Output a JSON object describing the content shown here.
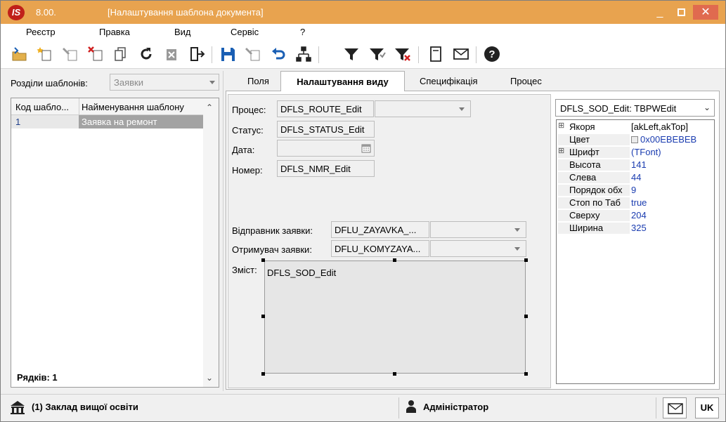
{
  "window": {
    "logo_text": "IS",
    "version": "8.00.",
    "title": "[Налаштування шаблона документа]",
    "buttons": {
      "minimize": "_",
      "close": "✕"
    }
  },
  "menu": [
    "Реєстр",
    "Правка",
    "Вид",
    "Сервіс",
    "?"
  ],
  "toolbar_icons": [
    "open-folder-icon",
    "new-item-icon",
    "edit-item-icon",
    "delete-item-icon",
    "copy-icon",
    "refresh-icon",
    "clear-icon",
    "exit-icon",
    "save-icon",
    "edit-icon",
    "undo-icon",
    "tree-icon",
    "filter-icon",
    "filter-set-icon",
    "filter-clear-icon",
    "document-icon",
    "mail-icon",
    "help-icon"
  ],
  "left_panel": {
    "sections_label": "Розділи шаблонів:",
    "sections_value": "Заявки",
    "columns": [
      "Код шабло...",
      "Найменування шаблону"
    ],
    "rows": [
      {
        "code": "1",
        "name": "Заявка на ремонт"
      }
    ],
    "rows_count": "Рядків: 1"
  },
  "tabs": [
    "Поля",
    "Налаштування виду",
    "Специфікація",
    "Процес"
  ],
  "active_tab": "Налаштування виду",
  "form": {
    "process_label": "Процес:",
    "process_value": "DFLS_ROUTE_Edit",
    "status_label": "Статус:",
    "status_value": "DFLS_STATUS_Edit",
    "date_label": "Дата:",
    "number_label": "Номер:",
    "number_value": "DFLS_NMR_Edit",
    "sender_label": "Відправник заявки:",
    "sender_value": "DFLU_ZAYAVKA_...",
    "receiver_label": "Отримувач заявки:",
    "receiver_value": "DFLU_KOMYZAYA...",
    "content_label": "Зміст:",
    "content_value": "DFLS_SOD_Edit"
  },
  "inspector": {
    "component": "DFLS_SOD_Edit: TBPWEdit",
    "properties": [
      {
        "name": "Якоря",
        "value": "[akLeft,akTop]",
        "expandable": true
      },
      {
        "name": "Цвет",
        "value": "0x00EBEBEB",
        "swatch": "#EBEBEB"
      },
      {
        "name": "Шрифт",
        "value": "(TFont)",
        "expandable": true
      },
      {
        "name": "Высота",
        "value": "141"
      },
      {
        "name": "Слева",
        "value": "44"
      },
      {
        "name": "Порядок обх",
        "value": "9"
      },
      {
        "name": "Стоп по Таб",
        "value": "true"
      },
      {
        "name": "Сверху",
        "value": "204"
      },
      {
        "name": "Ширина",
        "value": "325"
      }
    ]
  },
  "status": {
    "organization": "(1) Заклад вищої освіти",
    "user": "Адміністратор",
    "language": "UK"
  },
  "colors": {
    "titlebar": "#E8A34F",
    "close_button": "#E06A4F",
    "selected_row": "#A3A3A3",
    "property_value": "#1A3CB0"
  }
}
